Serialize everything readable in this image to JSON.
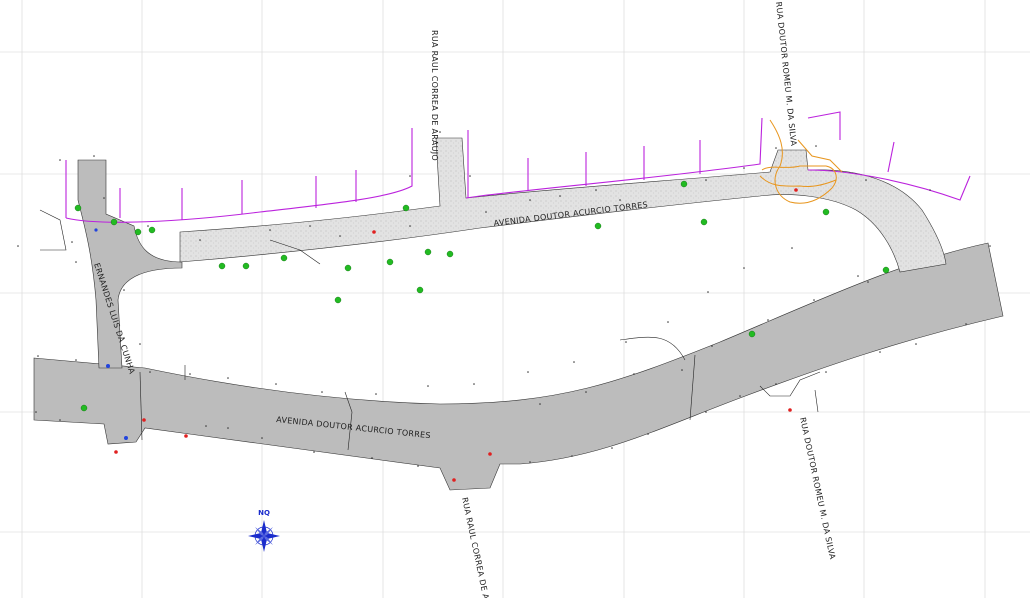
{
  "streets": {
    "avenida_north": "AVENIDA DOUTOR ACURCIO TORRES",
    "avenida_south": "AVENIDA DOUTOR ACURCIO TORRES",
    "rua_raul_north": "RUA RAUL CORREA DE ARAUJO",
    "rua_raul_south": "RUA RAUL CORREA DE ARAUJO",
    "rua_romeu_north": "RUA DOUTOR ROMEU M. DA SILVA",
    "rua_romeu_south": "RUA DOUTOR ROMEU M. DA SILVA",
    "rua_ernandes": "ERNANDES LUIS DA CUNHA"
  },
  "compass": {
    "label": "NQ"
  },
  "colors": {
    "road_asphalt": "#b9b9b9",
    "road_paver": "#dedede",
    "lot_lines": "#bb22dd",
    "green_points": "#22bb22",
    "red_points": "#e02020",
    "blue_points": "#2244dd",
    "orange_feature": "#e8961e",
    "compass": "#1a2ccc"
  }
}
